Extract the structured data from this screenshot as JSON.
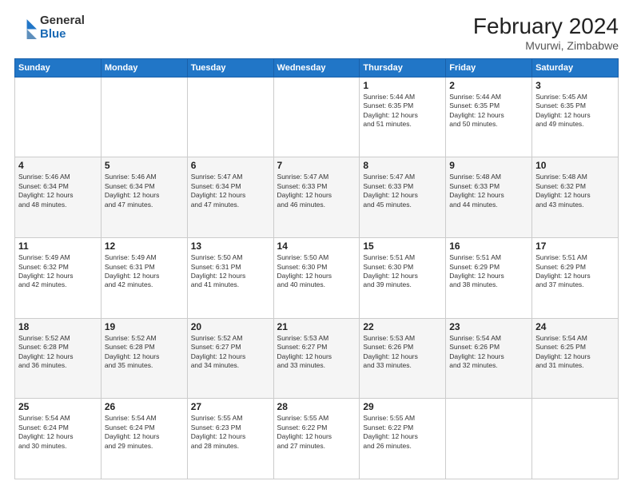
{
  "logo": {
    "general": "General",
    "blue": "Blue"
  },
  "title": "February 2024",
  "subtitle": "Mvurwi, Zimbabwe",
  "header_days": [
    "Sunday",
    "Monday",
    "Tuesday",
    "Wednesday",
    "Thursday",
    "Friday",
    "Saturday"
  ],
  "weeks": [
    [
      {
        "day": "",
        "info": ""
      },
      {
        "day": "",
        "info": ""
      },
      {
        "day": "",
        "info": ""
      },
      {
        "day": "",
        "info": ""
      },
      {
        "day": "1",
        "info": "Sunrise: 5:44 AM\nSunset: 6:35 PM\nDaylight: 12 hours\nand 51 minutes."
      },
      {
        "day": "2",
        "info": "Sunrise: 5:44 AM\nSunset: 6:35 PM\nDaylight: 12 hours\nand 50 minutes."
      },
      {
        "day": "3",
        "info": "Sunrise: 5:45 AM\nSunset: 6:35 PM\nDaylight: 12 hours\nand 49 minutes."
      }
    ],
    [
      {
        "day": "4",
        "info": "Sunrise: 5:46 AM\nSunset: 6:34 PM\nDaylight: 12 hours\nand 48 minutes."
      },
      {
        "day": "5",
        "info": "Sunrise: 5:46 AM\nSunset: 6:34 PM\nDaylight: 12 hours\nand 47 minutes."
      },
      {
        "day": "6",
        "info": "Sunrise: 5:47 AM\nSunset: 6:34 PM\nDaylight: 12 hours\nand 47 minutes."
      },
      {
        "day": "7",
        "info": "Sunrise: 5:47 AM\nSunset: 6:33 PM\nDaylight: 12 hours\nand 46 minutes."
      },
      {
        "day": "8",
        "info": "Sunrise: 5:47 AM\nSunset: 6:33 PM\nDaylight: 12 hours\nand 45 minutes."
      },
      {
        "day": "9",
        "info": "Sunrise: 5:48 AM\nSunset: 6:33 PM\nDaylight: 12 hours\nand 44 minutes."
      },
      {
        "day": "10",
        "info": "Sunrise: 5:48 AM\nSunset: 6:32 PM\nDaylight: 12 hours\nand 43 minutes."
      }
    ],
    [
      {
        "day": "11",
        "info": "Sunrise: 5:49 AM\nSunset: 6:32 PM\nDaylight: 12 hours\nand 42 minutes."
      },
      {
        "day": "12",
        "info": "Sunrise: 5:49 AM\nSunset: 6:31 PM\nDaylight: 12 hours\nand 42 minutes."
      },
      {
        "day": "13",
        "info": "Sunrise: 5:50 AM\nSunset: 6:31 PM\nDaylight: 12 hours\nand 41 minutes."
      },
      {
        "day": "14",
        "info": "Sunrise: 5:50 AM\nSunset: 6:30 PM\nDaylight: 12 hours\nand 40 minutes."
      },
      {
        "day": "15",
        "info": "Sunrise: 5:51 AM\nSunset: 6:30 PM\nDaylight: 12 hours\nand 39 minutes."
      },
      {
        "day": "16",
        "info": "Sunrise: 5:51 AM\nSunset: 6:29 PM\nDaylight: 12 hours\nand 38 minutes."
      },
      {
        "day": "17",
        "info": "Sunrise: 5:51 AM\nSunset: 6:29 PM\nDaylight: 12 hours\nand 37 minutes."
      }
    ],
    [
      {
        "day": "18",
        "info": "Sunrise: 5:52 AM\nSunset: 6:28 PM\nDaylight: 12 hours\nand 36 minutes."
      },
      {
        "day": "19",
        "info": "Sunrise: 5:52 AM\nSunset: 6:28 PM\nDaylight: 12 hours\nand 35 minutes."
      },
      {
        "day": "20",
        "info": "Sunrise: 5:52 AM\nSunset: 6:27 PM\nDaylight: 12 hours\nand 34 minutes."
      },
      {
        "day": "21",
        "info": "Sunrise: 5:53 AM\nSunset: 6:27 PM\nDaylight: 12 hours\nand 33 minutes."
      },
      {
        "day": "22",
        "info": "Sunrise: 5:53 AM\nSunset: 6:26 PM\nDaylight: 12 hours\nand 33 minutes."
      },
      {
        "day": "23",
        "info": "Sunrise: 5:54 AM\nSunset: 6:26 PM\nDaylight: 12 hours\nand 32 minutes."
      },
      {
        "day": "24",
        "info": "Sunrise: 5:54 AM\nSunset: 6:25 PM\nDaylight: 12 hours\nand 31 minutes."
      }
    ],
    [
      {
        "day": "25",
        "info": "Sunrise: 5:54 AM\nSunset: 6:24 PM\nDaylight: 12 hours\nand 30 minutes."
      },
      {
        "day": "26",
        "info": "Sunrise: 5:54 AM\nSunset: 6:24 PM\nDaylight: 12 hours\nand 29 minutes."
      },
      {
        "day": "27",
        "info": "Sunrise: 5:55 AM\nSunset: 6:23 PM\nDaylight: 12 hours\nand 28 minutes."
      },
      {
        "day": "28",
        "info": "Sunrise: 5:55 AM\nSunset: 6:22 PM\nDaylight: 12 hours\nand 27 minutes."
      },
      {
        "day": "29",
        "info": "Sunrise: 5:55 AM\nSunset: 6:22 PM\nDaylight: 12 hours\nand 26 minutes."
      },
      {
        "day": "",
        "info": ""
      },
      {
        "day": "",
        "info": ""
      }
    ]
  ]
}
